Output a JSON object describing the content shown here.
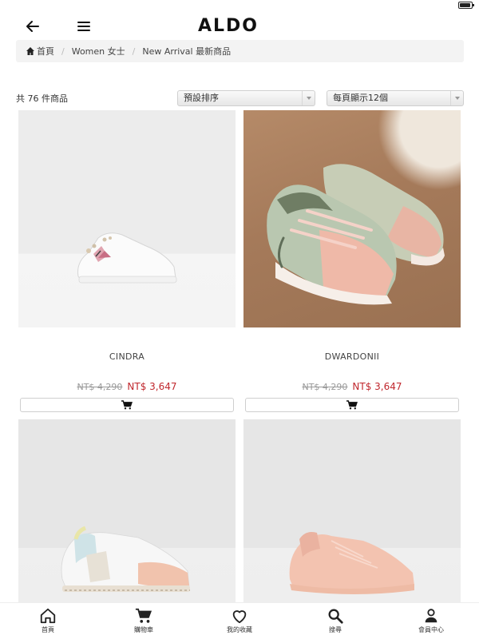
{
  "header": {
    "brand": "ALDO"
  },
  "breadcrumb": {
    "items": [
      {
        "label": "首頁"
      },
      {
        "label": "Women 女士"
      },
      {
        "label": "New Arrival 最新商品"
      }
    ]
  },
  "toolbar": {
    "count_label": "共 76 件商品",
    "sort_selected": "預設排序",
    "perpage_selected": "每頁顯示12個"
  },
  "products": [
    {
      "name": "CINDRA",
      "old_price": "NT$ 4,290",
      "price": "NT$ 3,647"
    },
    {
      "name": "DWARDONII",
      "old_price": "NT$ 4,290",
      "price": "NT$ 3,647"
    },
    {
      "name": "",
      "old_price": "",
      "price": ""
    },
    {
      "name": "",
      "old_price": "",
      "price": ""
    }
  ],
  "bottom_nav": {
    "items": [
      {
        "label": "首頁",
        "icon": "home-icon"
      },
      {
        "label": "購物車",
        "icon": "cart-icon"
      },
      {
        "label": "我的收藏",
        "icon": "heart-icon"
      },
      {
        "label": "搜尋",
        "icon": "search-icon"
      },
      {
        "label": "會員中心",
        "icon": "user-icon"
      }
    ]
  },
  "colors": {
    "sale_price": "#c0272d",
    "old_price": "#999999"
  }
}
